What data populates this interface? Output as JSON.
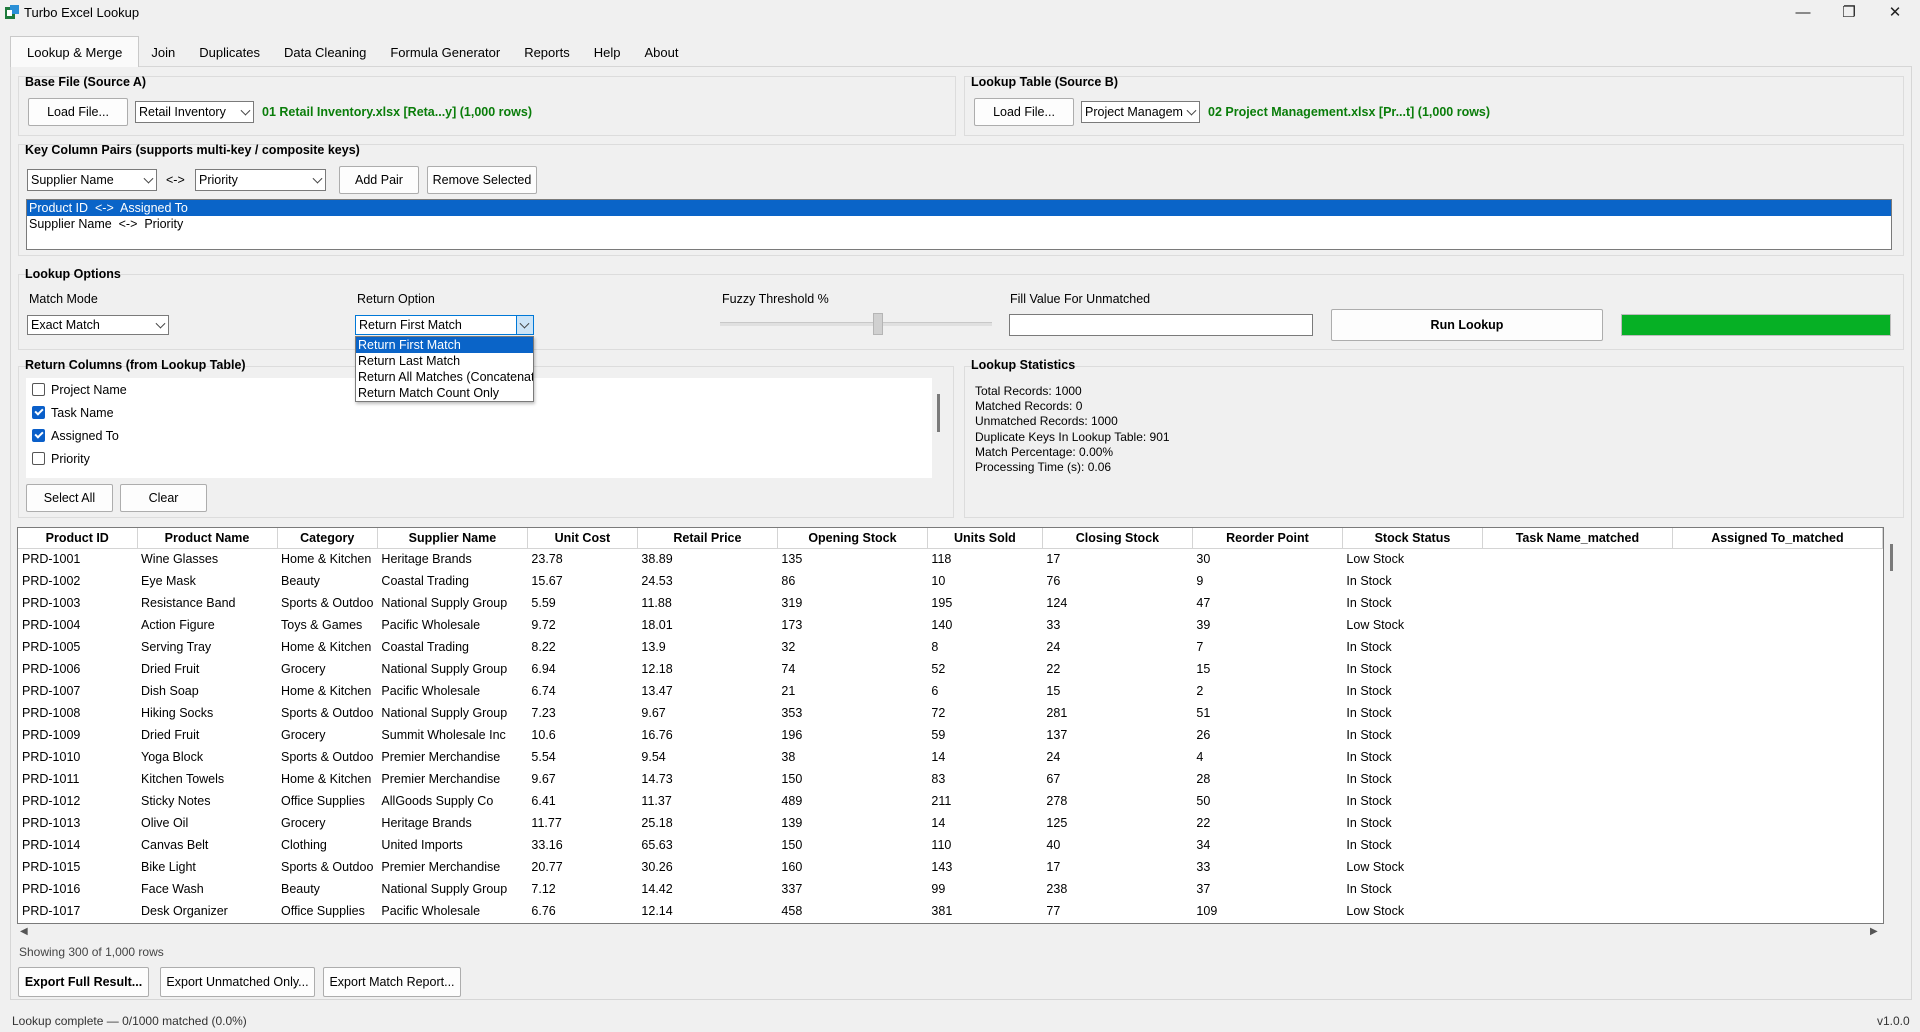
{
  "window": {
    "title": "Turbo Excel Lookup",
    "minimize": "—",
    "restore": "❐",
    "close": "✕"
  },
  "tabs": [
    "Lookup & Merge",
    "Join",
    "Duplicates",
    "Data Cleaning",
    "Formula Generator",
    "Reports",
    "Help",
    "About"
  ],
  "source_a": {
    "title": "Base File (Source A)",
    "load_label": "Load File...",
    "sheet": "Retail Inventory",
    "file_info": "01 Retail Inventory.xlsx  [Reta...y]  (1,000 rows)"
  },
  "source_b": {
    "title": "Lookup Table (Source B)",
    "load_label": "Load File...",
    "sheet": "Project Management",
    "file_info": "02 Project Management.xlsx  [Pr...t]  (1,000 rows)"
  },
  "keys": {
    "title": "Key Column Pairs  (supports multi-key / composite keys)",
    "left_column": "Supplier Name",
    "arrow": "<->",
    "right_column": "Priority",
    "add_label": "Add Pair",
    "remove_label": "Remove Selected",
    "pairs": [
      "Product ID  <->  Assigned To",
      "Supplier Name  <->  Priority"
    ]
  },
  "options": {
    "title": "Lookup Options",
    "match_mode_label": "Match Mode",
    "match_mode": "Exact Match",
    "return_option_label": "Return Option",
    "return_option": "Return First Match",
    "return_option_items": [
      "Return First Match",
      "Return Last Match",
      "Return All Matches (Concatenate",
      "Return Match Count Only"
    ],
    "fuzzy_label": "Fuzzy Threshold %",
    "fuzzy_value_fraction": 0.58,
    "fill_label": "Fill Value For Unmatched",
    "fill_value": "",
    "run_label": "Run Lookup",
    "progress_fraction": 1.0,
    "progress_color": "#06b025"
  },
  "return_columns": {
    "title": "Return Columns (from Lookup Table)",
    "items": [
      {
        "label": "Project Name",
        "checked": false
      },
      {
        "label": "Task Name",
        "checked": true
      },
      {
        "label": "Assigned To",
        "checked": true
      },
      {
        "label": "Priority",
        "checked": false
      }
    ],
    "select_all_label": "Select All",
    "clear_label": "Clear"
  },
  "stats": {
    "title": "Lookup Statistics",
    "lines": [
      "Total Records: 1000",
      "Matched Records: 0",
      "Unmatched Records: 1000",
      "Duplicate Keys In Lookup Table: 901",
      "Match Percentage: 0.00%",
      "Processing Time (s): 0.06"
    ]
  },
  "table": {
    "columns": [
      "Product ID",
      "Product Name",
      "Category",
      "Supplier Name",
      "Unit Cost",
      "Retail Price",
      "Opening Stock",
      "Units Sold",
      "Closing Stock",
      "Reorder Point",
      "Stock Status",
      "Task Name_matched",
      "Assigned To_matched"
    ],
    "rows": [
      [
        "PRD-1001",
        "Wine Glasses",
        "Home & Kitchen",
        "Heritage Brands",
        "23.78",
        "38.89",
        "135",
        "118",
        "17",
        "30",
        "Low Stock",
        "",
        ""
      ],
      [
        "PRD-1002",
        "Eye Mask",
        "Beauty",
        "Coastal Trading",
        "15.67",
        "24.53",
        "86",
        "10",
        "76",
        "9",
        "In Stock",
        "",
        ""
      ],
      [
        "PRD-1003",
        "Resistance Band",
        "Sports & Outdoo",
        "National Supply Group",
        "5.59",
        "11.88",
        "319",
        "195",
        "124",
        "47",
        "In Stock",
        "",
        ""
      ],
      [
        "PRD-1004",
        "Action Figure",
        "Toys & Games",
        "Pacific Wholesale",
        "9.72",
        "18.01",
        "173",
        "140",
        "33",
        "39",
        "Low Stock",
        "",
        ""
      ],
      [
        "PRD-1005",
        "Serving Tray",
        "Home & Kitchen",
        "Coastal Trading",
        "8.22",
        "13.9",
        "32",
        "8",
        "24",
        "7",
        "In Stock",
        "",
        ""
      ],
      [
        "PRD-1006",
        "Dried Fruit",
        "Grocery",
        "National Supply Group",
        "6.94",
        "12.18",
        "74",
        "52",
        "22",
        "15",
        "In Stock",
        "",
        ""
      ],
      [
        "PRD-1007",
        "Dish Soap",
        "Home & Kitchen",
        "Pacific Wholesale",
        "6.74",
        "13.47",
        "21",
        "6",
        "15",
        "2",
        "In Stock",
        "",
        ""
      ],
      [
        "PRD-1008",
        "Hiking Socks",
        "Sports & Outdoo",
        "National Supply Group",
        "7.23",
        "9.67",
        "353",
        "72",
        "281",
        "51",
        "In Stock",
        "",
        ""
      ],
      [
        "PRD-1009",
        "Dried Fruit",
        "Grocery",
        "Summit Wholesale Inc",
        "10.6",
        "16.76",
        "196",
        "59",
        "137",
        "26",
        "In Stock",
        "",
        ""
      ],
      [
        "PRD-1010",
        "Yoga Block",
        "Sports & Outdoo",
        "Premier Merchandise",
        "5.54",
        "9.54",
        "38",
        "14",
        "24",
        "4",
        "In Stock",
        "",
        ""
      ],
      [
        "PRD-1011",
        "Kitchen Towels",
        "Home & Kitchen",
        "Premier Merchandise",
        "9.67",
        "14.73",
        "150",
        "83",
        "67",
        "28",
        "In Stock",
        "",
        ""
      ],
      [
        "PRD-1012",
        "Sticky Notes",
        "Office Supplies",
        "AllGoods Supply Co",
        "6.41",
        "11.37",
        "489",
        "211",
        "278",
        "50",
        "In Stock",
        "",
        ""
      ],
      [
        "PRD-1013",
        "Olive Oil",
        "Grocery",
        "Heritage Brands",
        "11.77",
        "25.18",
        "139",
        "14",
        "125",
        "22",
        "In Stock",
        "",
        ""
      ],
      [
        "PRD-1014",
        "Canvas Belt",
        "Clothing",
        "United Imports",
        "33.16",
        "65.63",
        "150",
        "110",
        "40",
        "34",
        "In Stock",
        "",
        ""
      ],
      [
        "PRD-1015",
        "Bike Light",
        "Sports & Outdoo",
        "Premier Merchandise",
        "20.77",
        "30.26",
        "160",
        "143",
        "17",
        "33",
        "Low Stock",
        "",
        ""
      ],
      [
        "PRD-1016",
        "Face Wash",
        "Beauty",
        "National Supply Group",
        "7.12",
        "14.42",
        "337",
        "99",
        "238",
        "37",
        "In Stock",
        "",
        ""
      ],
      [
        "PRD-1017",
        "Desk Organizer",
        "Office Supplies",
        "Pacific Wholesale",
        "6.76",
        "12.14",
        "458",
        "381",
        "77",
        "109",
        "Low Stock",
        "",
        ""
      ]
    ],
    "showing": "Showing 300 of 1,000 rows"
  },
  "export": {
    "full_label": "Export Full Result...",
    "unmatched_label": "Export Unmatched Only...",
    "report_label": "Export Match Report..."
  },
  "statusbar": {
    "message": "Lookup complete — 0/1000 matched (0.0%)",
    "version": "v1.0.0"
  }
}
